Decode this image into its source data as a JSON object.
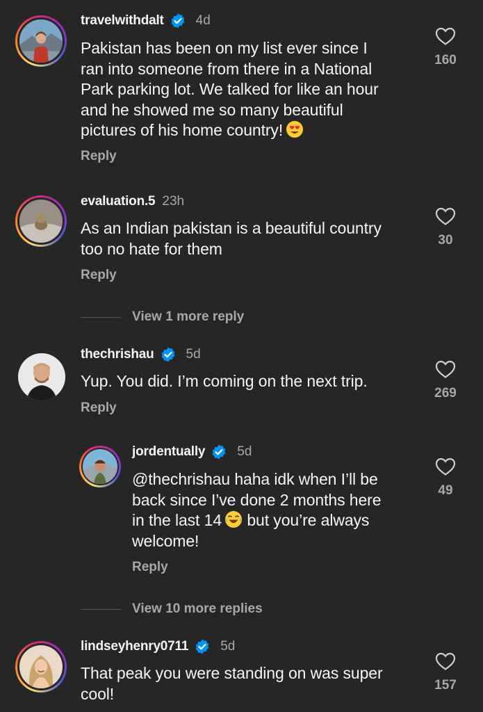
{
  "colors": {
    "background": "#262626",
    "text_primary": "#f5f5f5",
    "text_secondary": "#a8a8a8",
    "verified": "#0095f6"
  },
  "comments": [
    {
      "username": "travelwithdalt",
      "verified": true,
      "time": "4d",
      "text_lines": [
        "Pakistan has been on my list ever since I",
        "ran into someone from there in a National",
        "Park parking lot. We talked for like an hour",
        "and he showed me so many beautiful",
        "pictures of his home country!"
      ],
      "emoji": "heart-eyes-emoji",
      "reply_label": "Reply",
      "likes": "160"
    },
    {
      "username": "evaluation.5",
      "verified": false,
      "time": "23h",
      "text_lines": [
        "As an Indian pakistan is a beautiful country",
        "too no hate for them"
      ],
      "reply_label": "Reply",
      "likes": "30",
      "view_more": "View 1 more reply"
    },
    {
      "username": "thechrishau",
      "verified": true,
      "time": "5d",
      "text_lines": [
        "Yup. You did. I’m coming on the next trip."
      ],
      "reply_label": "Reply",
      "likes": "269"
    },
    {
      "username": "jordentually",
      "verified": true,
      "time": "5d",
      "text_lines": [
        "@thechrishau haha idk when I’ll be",
        "back since I’ve done 2 months here",
        "in the last 14",
        "welcome!"
      ],
      "inline_text_after_emoji": "but you’re always",
      "emoji": "laughing-emoji",
      "reply_label": "Reply",
      "likes": "49",
      "view_more": "View 10 more replies"
    },
    {
      "username": "lindseyhenry0711",
      "verified": true,
      "time": "5d",
      "text_lines": [
        "That peak you were standing on was super",
        "cool!"
      ],
      "likes": "157"
    }
  ]
}
